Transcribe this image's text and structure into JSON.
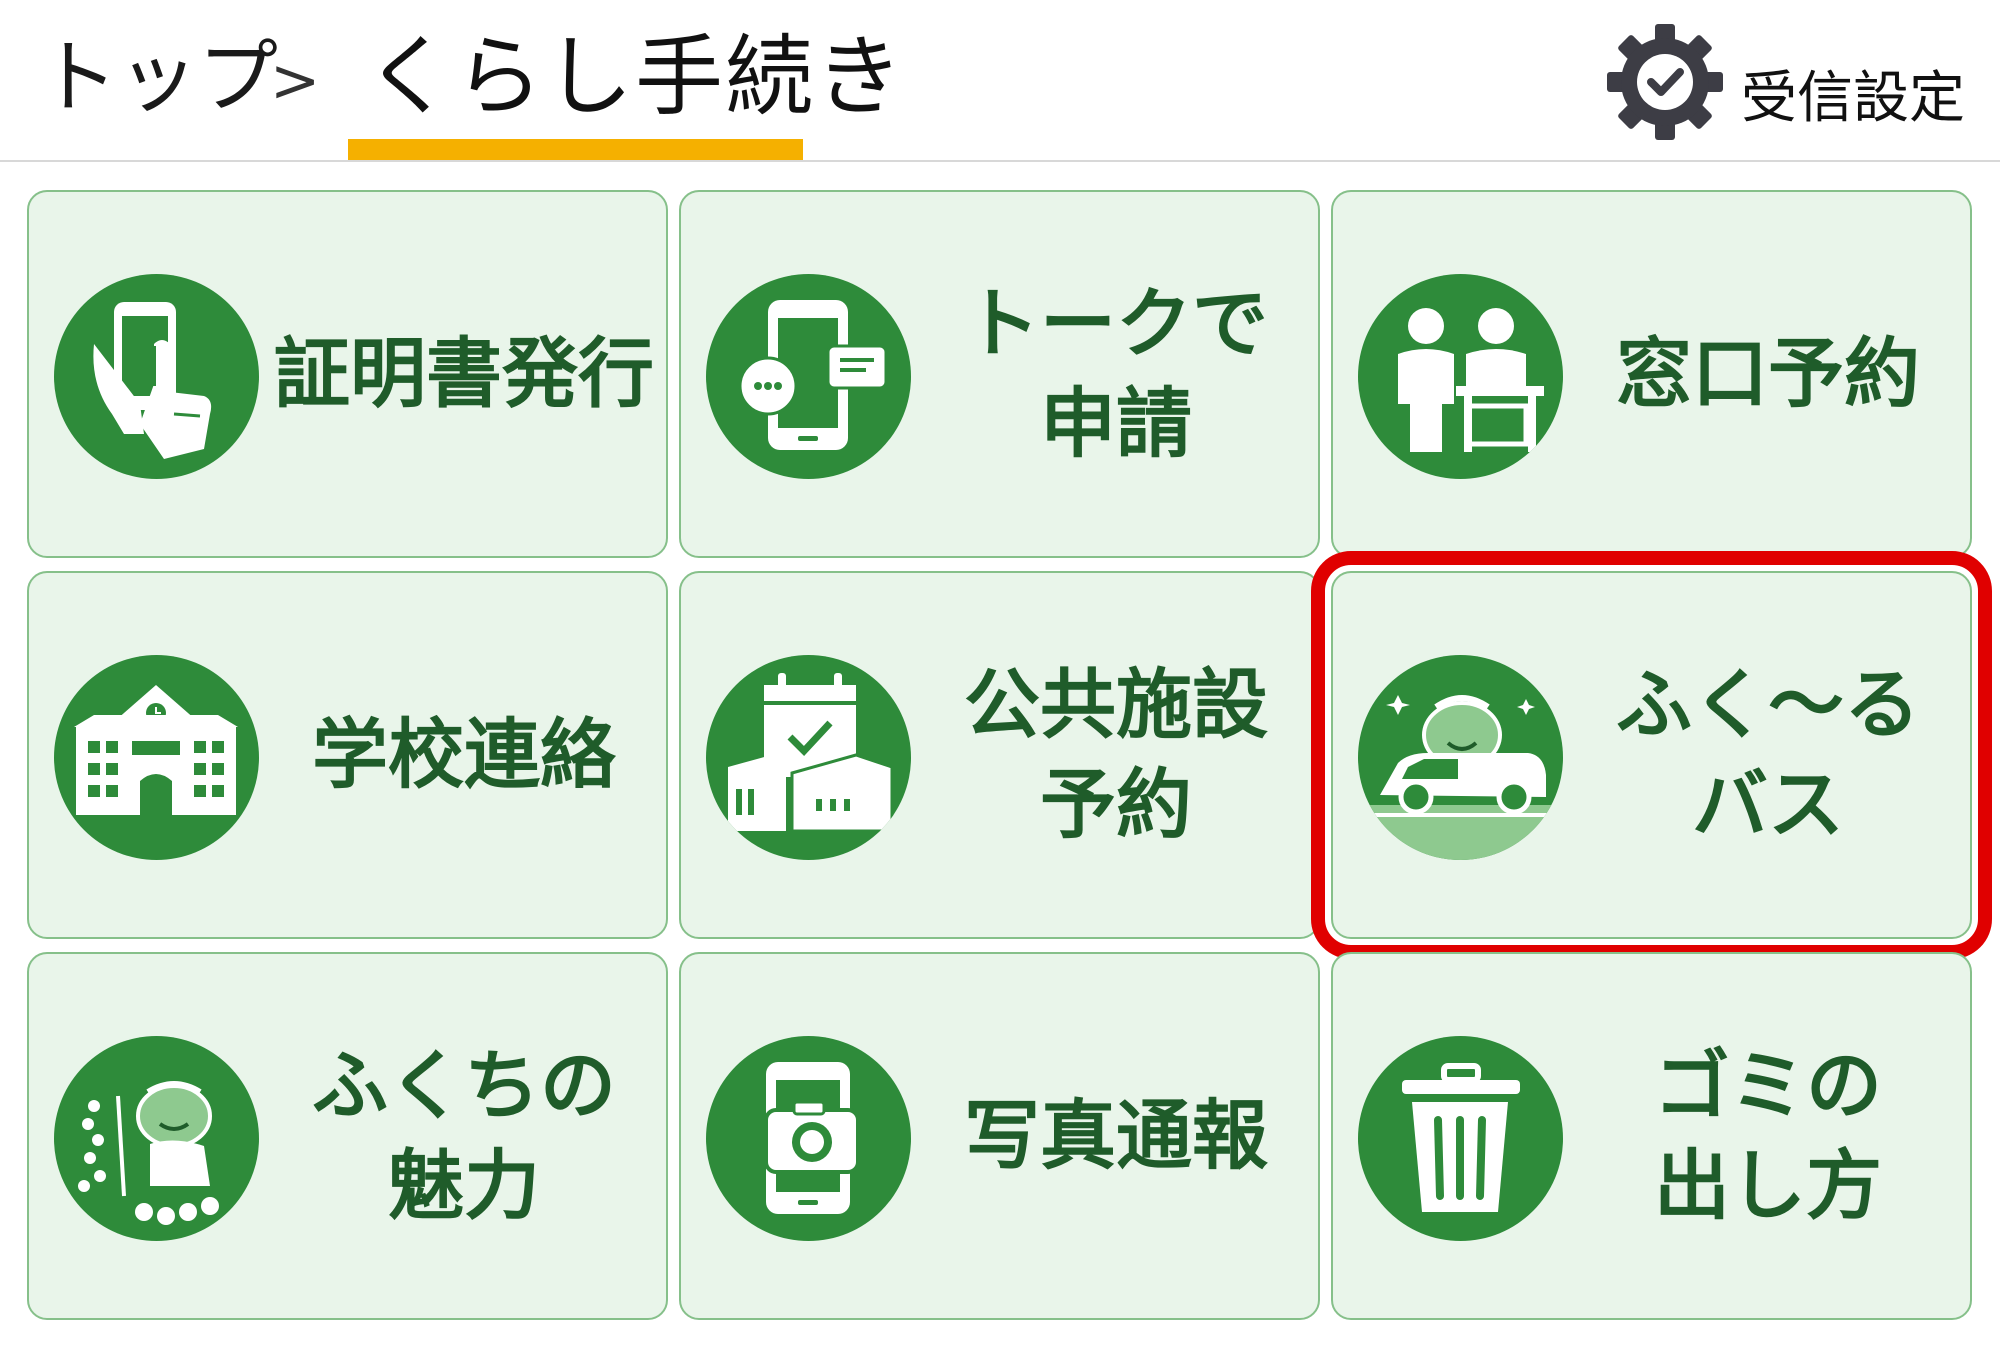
{
  "breadcrumb": {
    "top": "トップ",
    "separator": ">",
    "current": "くらし手続き"
  },
  "settings": {
    "label": "受信設定",
    "icon": "gear-check-icon"
  },
  "tiles": [
    {
      "label": "証明書発行",
      "icon": "smartphone-hand-icon"
    },
    {
      "label": "トークで\n申請",
      "icon": "smartphone-chat-icon"
    },
    {
      "label": "窓口予約",
      "icon": "service-counter-icon"
    },
    {
      "label": "学校連絡",
      "icon": "school-building-icon"
    },
    {
      "label": "公共施設\n予約",
      "icon": "calendar-facility-icon"
    },
    {
      "label": "ふく～る\nバス",
      "icon": "mascot-bus-icon"
    },
    {
      "label": "ふくちの\n魅力",
      "icon": "mascot-flowers-icon"
    },
    {
      "label": "写真通報",
      "icon": "smartphone-camera-icon"
    },
    {
      "label": "ゴミの\n出し方",
      "icon": "trash-can-icon"
    }
  ],
  "colors": {
    "accent_underline": "#f5b000",
    "icon_green": "#2e8b3a",
    "tile_bg": "#e9f5ea",
    "label_green": "#1f5c2a",
    "highlight": "#e00000"
  }
}
